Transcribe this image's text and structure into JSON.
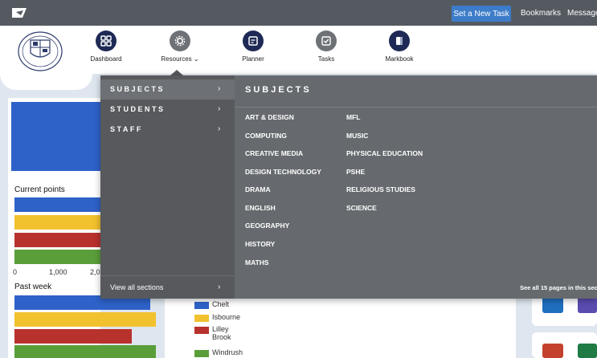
{
  "topbar": {
    "new_task_label": "Set a New Task",
    "bookmarks_label": "Bookmarks",
    "messages_label": "Messages",
    "logo_icon": "app-logo-icon"
  },
  "nav": {
    "items": [
      {
        "label": "Dashboard",
        "icon": "dashboard-grid-icon"
      },
      {
        "label": "Resources",
        "icon": "resources-cog-icon",
        "has_caret": true
      },
      {
        "label": "Planner",
        "icon": "planner-icon"
      },
      {
        "label": "Tasks",
        "icon": "tasks-check-icon"
      },
      {
        "label": "Markbook",
        "icon": "markbook-icon"
      }
    ]
  },
  "dashboard": {
    "current_points_title": "Current points",
    "past_week_title": "Past week",
    "axis_ticks": [
      "0",
      "1,000",
      "2,0"
    ],
    "legend": [
      {
        "label": "Chelt",
        "color": "#2e62c9"
      },
      {
        "label": "Isbourne",
        "color": "#f2c12e"
      },
      {
        "label": "Lilley Brook",
        "color": "#b8322d"
      },
      {
        "label": "Windrush",
        "color": "#5a9e3a"
      }
    ]
  },
  "dropdown": {
    "menu": [
      {
        "label": "SUBJECTS",
        "active": true
      },
      {
        "label": "STUDENTS",
        "active": false
      },
      {
        "label": "STAFF",
        "active": false
      }
    ],
    "view_all_label": "View all sections",
    "subjects_heading": "SUBJECTS",
    "subjects_col1": [
      "ART & DESIGN",
      "COMPUTING",
      "CREATIVE MEDIA",
      "DESIGN TECHNOLOGY",
      "DRAMA",
      "ENGLISH",
      "GEOGRAPHY",
      "HISTORY",
      "MATHS"
    ],
    "subjects_col2": [
      "MFL",
      "MUSIC",
      "PHYSICAL EDUCATION",
      "PSHE",
      "RELIGIOUS STUDIES",
      "SCIENCE"
    ],
    "see_all_label": "See all 15 pages in this sec"
  }
}
